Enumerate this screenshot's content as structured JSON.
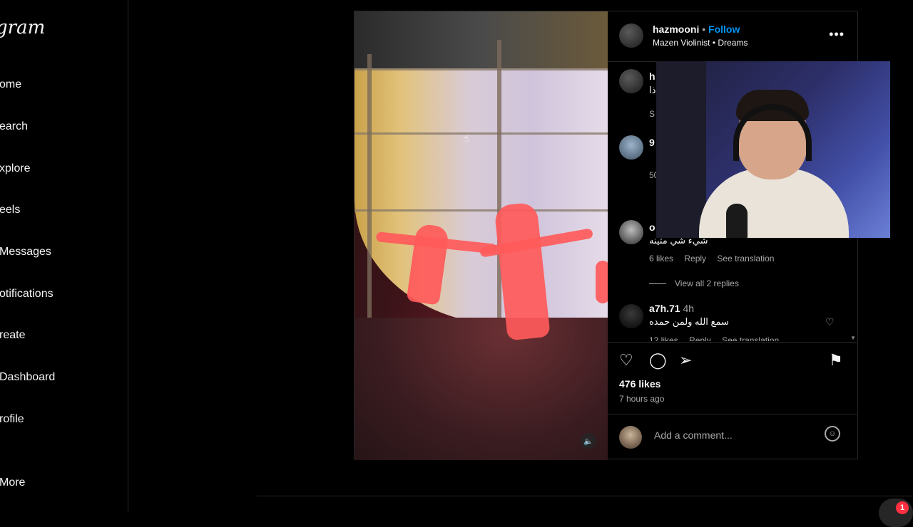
{
  "sidebar": {
    "logo": "gram",
    "items": [
      {
        "label": "ome"
      },
      {
        "label": "earch"
      },
      {
        "label": "xplore"
      },
      {
        "label": "eels"
      },
      {
        "label": "Messages"
      },
      {
        "label": "otifications"
      },
      {
        "label": "reate"
      },
      {
        "label": "Dashboard"
      },
      {
        "label": "rofile"
      },
      {
        "label": "More"
      }
    ]
  },
  "post": {
    "header": {
      "username": "hazmooni",
      "separator": "•",
      "follow_label": "Follow",
      "audio": "Mazen Violinist • Dreams"
    },
    "comments": [
      {
        "username": "h",
        "text": "ذا",
        "meta": "S"
      },
      {
        "username": "9",
        "text": "",
        "meta": "50"
      },
      {
        "username": "o",
        "text": "شيء شي متينه",
        "likes": "6 likes",
        "reply": "Reply",
        "translate": "See translation"
      },
      {
        "username": "a7h.71",
        "time": "4h",
        "text": "سمع الله ولمن حمده",
        "likes": "12 likes",
        "reply": "Reply",
        "translate": "See translation"
      }
    ],
    "view_replies": "View all 2 replies",
    "likes": "476 likes",
    "time_ago": "7 hours ago",
    "comment_placeholder": "Add a comment..."
  },
  "notifications": {
    "count": "1"
  },
  "colors": {
    "accent": "#0095f6",
    "background": "#000000",
    "notification": "#ff3040"
  }
}
